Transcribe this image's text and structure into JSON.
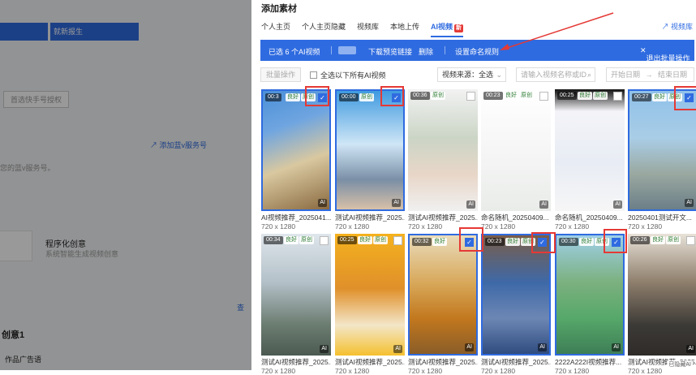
{
  "background": {
    "tabs": [
      "",
      "就新报生"
    ],
    "button_label": "首选快手号授权",
    "link_label": "添加蓝v服务号",
    "hint_text": "您的蓝v服务号。",
    "card_title": "程序化创意",
    "card_desc": "系统智能生成视频创意",
    "section_title": "创意1",
    "section_subtitle": "作品广告语",
    "side_label": "查"
  },
  "drawer": {
    "title": "添加素材",
    "tabs": [
      {
        "label": "个人主页",
        "active": false
      },
      {
        "label": "个人主页隐藏",
        "active": false
      },
      {
        "label": "视频库",
        "active": false
      },
      {
        "label": "本地上传",
        "active": false
      },
      {
        "label": "AI视频",
        "active": true,
        "badge": "新"
      }
    ],
    "library_link": "视频库",
    "batch_bar": {
      "selected": "已选 6 个AI视频",
      "download": "下载预览链接",
      "delete": "删除",
      "rename": "设置命名规则",
      "exit": "退出批量操作"
    },
    "toolbar": {
      "batch_op": "批量操作",
      "select_all": "全选以下所有AI视频",
      "source_select": "视频来源：全选",
      "search_placeholder": "请输入视频名称或ID",
      "start_date": "开始日期",
      "date_sep": "→",
      "end_date": "结束日期"
    },
    "videos": [
      {
        "duration": "00:3",
        "tags": [
          "良好",
          "原创"
        ],
        "selected": true,
        "caption": "AI视频推荐_2025041...",
        "size": "720 x 1280"
      },
      {
        "duration": "00:00",
        "tags": [
          "原创"
        ],
        "selected": true,
        "caption": "测试AI视频推荐_2025...",
        "size": "720 x 1280"
      },
      {
        "duration": "00:36",
        "tags": [
          "原创"
        ],
        "selected": false,
        "caption": "测试AI视频推荐_2025...",
        "size": "720 x 1280"
      },
      {
        "duration": "00:23",
        "tags": [
          "良好",
          "原创"
        ],
        "selected": false,
        "caption": "命名随机_20250409...",
        "size": "720 x 1280"
      },
      {
        "duration": "00:25",
        "tags": [
          "良好",
          "原创"
        ],
        "selected": false,
        "caption": "命名随机_20250409...",
        "size": "720 x 1280"
      },
      {
        "duration": "00:27",
        "tags": [
          "良好",
          "原创"
        ],
        "selected": true,
        "caption": "20250401测试开文...",
        "size": "720 x 1280"
      },
      {
        "duration": "00:34",
        "tags": [
          "良好",
          "原创"
        ],
        "selected": false,
        "caption": "测试AI视频推荐_2025...",
        "size": "720 x 1280"
      },
      {
        "duration": "00:25",
        "tags": [
          "良好",
          "原创"
        ],
        "selected": false,
        "caption": "测试AI视频推荐_2025...",
        "size": "720 x 1280"
      },
      {
        "duration": "00:32",
        "tags": [
          "良好"
        ],
        "selected": true,
        "caption": "测试AI视频推荐_2025...",
        "size": "720 x 1280"
      },
      {
        "duration": "00:23",
        "tags": [
          "良好",
          "原创"
        ],
        "selected": true,
        "caption": "测试AI视频推荐_2025...",
        "size": "720 x 1280"
      },
      {
        "duration": "00:30",
        "tags": [
          "良好",
          "原创"
        ],
        "selected": true,
        "caption": "2222A222I视频推荐...",
        "size": "720 x 1280"
      },
      {
        "duration": "00:26",
        "tags": [
          "良好",
          "原创"
        ],
        "selected": false,
        "caption": "测试AI视频推荐_2025...",
        "size": "720 x 1280"
      }
    ],
    "ai_label": "AI",
    "watermark": "已隐藏AI"
  },
  "colors": {
    "accent": "#2f6be0",
    "annotation": "#e53935"
  }
}
